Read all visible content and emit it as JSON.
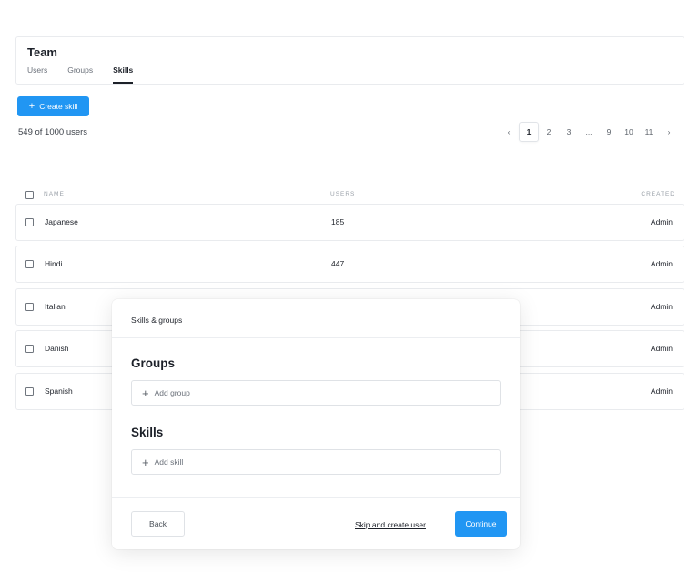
{
  "header": {
    "title": "Team",
    "tabs": [
      {
        "label": "Users",
        "active": false
      },
      {
        "label": "Groups",
        "active": false
      },
      {
        "label": "Skills",
        "active": true
      }
    ]
  },
  "toolbar": {
    "create_label": "Create skill",
    "create_icon": "plus-icon",
    "count_text": "549 of 1000 users"
  },
  "pagination": {
    "prev_icon": "chevron-left-icon",
    "next_icon": "chevron-right-icon",
    "pages": [
      "1",
      "2",
      "3",
      "...",
      "9",
      "10",
      "11"
    ],
    "current": "1"
  },
  "table": {
    "columns": {
      "name": "NAME",
      "users": "USERS",
      "created": "CREATED"
    },
    "rows": [
      {
        "name": "Japanese",
        "users": "185",
        "created": "Admin"
      },
      {
        "name": "Hindi",
        "users": "447",
        "created": "Admin"
      },
      {
        "name": "Italian",
        "users": "",
        "created": "Admin"
      },
      {
        "name": "Danish",
        "users": "",
        "created": "Admin"
      },
      {
        "name": "Spanish",
        "users": "",
        "created": "Admin"
      }
    ]
  },
  "modal": {
    "title": "Skills & groups",
    "groups_title": "Groups",
    "add_group_label": "Add group",
    "skills_title": "Skills",
    "add_skill_label": "Add skill",
    "back_label": "Back",
    "skip_label": "Skip and create user",
    "continue_label": "Continue"
  },
  "colors": {
    "accent": "#2196f3",
    "text": "#1d2129",
    "border": "#e9ebee"
  }
}
